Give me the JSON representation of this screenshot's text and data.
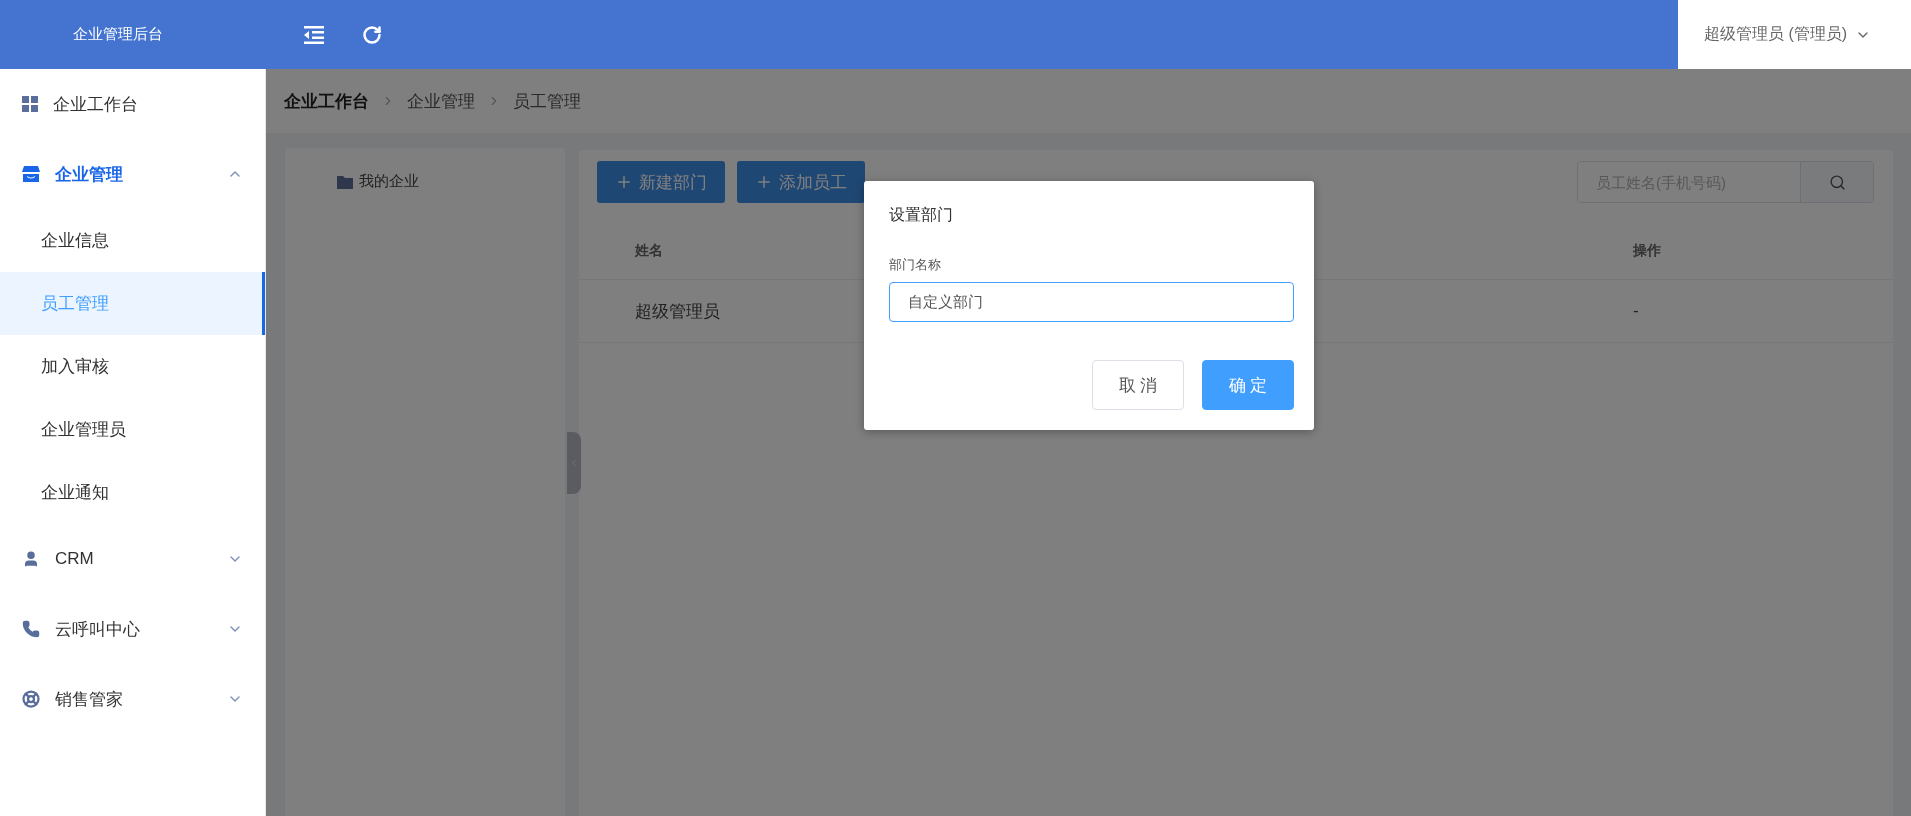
{
  "header": {
    "title": "企业管理后台",
    "user": "超级管理员 (管理员)"
  },
  "sidebar": {
    "items": [
      {
        "label": "企业工作台",
        "kind": "link",
        "selected": false
      },
      {
        "label": "企业管理",
        "kind": "group",
        "expanded": true,
        "selected": true,
        "children": [
          {
            "label": "企业信息",
            "selected": false
          },
          {
            "label": "员工管理",
            "selected": true
          },
          {
            "label": "加入审核",
            "selected": false
          },
          {
            "label": "企业管理员",
            "selected": false
          },
          {
            "label": "企业通知",
            "selected": false
          }
        ]
      },
      {
        "label": "CRM",
        "kind": "group",
        "expanded": false,
        "selected": false
      },
      {
        "label": "云呼叫中心",
        "kind": "group",
        "expanded": false,
        "selected": false
      },
      {
        "label": "销售管家",
        "kind": "group",
        "expanded": false,
        "selected": false
      }
    ]
  },
  "breadcrumb": [
    "企业工作台",
    "企业管理",
    "员工管理"
  ],
  "tree": {
    "items": [
      {
        "label": "我的企业"
      }
    ]
  },
  "toolbar": {
    "buttons": [
      "新建部门",
      "添加员工"
    ],
    "search": {
      "placeholder": "员工姓名(手机号码)"
    }
  },
  "table": {
    "columns": [
      "姓名",
      "操作"
    ],
    "rows": [
      [
        "超级管理员",
        "-"
      ]
    ]
  },
  "dialog": {
    "title": "设置部门",
    "field": {
      "label": "部门名称",
      "value": "自定义部门"
    },
    "buttons": [
      {
        "label": "取 消",
        "kind": "secondary"
      },
      {
        "label": "确 定",
        "kind": "primary"
      }
    ]
  }
}
